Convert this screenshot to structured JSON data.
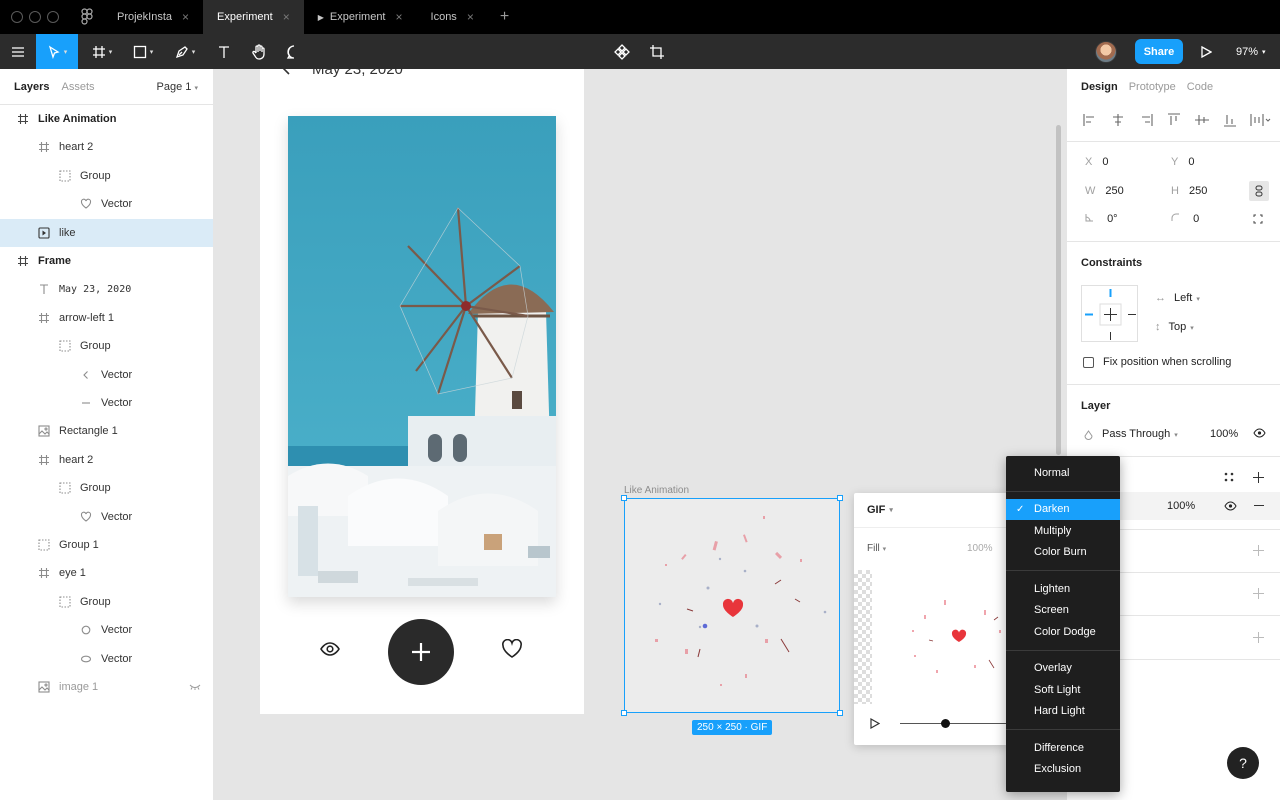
{
  "tabs": {
    "items": [
      {
        "label": "ProjekInsta",
        "active": false
      },
      {
        "label": "Experiment",
        "active": true
      },
      {
        "label": "Experiment",
        "active": false,
        "prototype": true
      },
      {
        "label": "Icons",
        "active": false
      }
    ],
    "close_glyph": "×",
    "add_glyph": "+"
  },
  "toolbar": {
    "share_label": "Share",
    "zoom_label": "97%",
    "caret": "▾",
    "icons": [
      "menu-icon",
      "move-tool-icon",
      "frame-tool-icon",
      "shape-tool-icon",
      "pen-tool-icon",
      "text-tool-icon",
      "hand-tool-icon",
      "comment-tool-icon",
      "component-icon",
      "crop-icon",
      "present-icon"
    ]
  },
  "layers_panel": {
    "tab_layers": "Layers",
    "tab_assets": "Assets",
    "page_label": "Page 1",
    "items": [
      {
        "label": "Like Animation",
        "icon": "frame-icon",
        "indent": 0,
        "bold": true
      },
      {
        "label": "heart 2",
        "icon": "frame-icon",
        "indent": 1
      },
      {
        "label": "Group",
        "icon": "group-icon",
        "indent": 2
      },
      {
        "label": "Vector",
        "icon": "heart-icon",
        "indent": 3
      },
      {
        "label": "like",
        "icon": "gif-icon",
        "indent": 1,
        "selected": true
      },
      {
        "label": "Frame",
        "icon": "frame-icon",
        "indent": 0,
        "bold": true
      },
      {
        "label": "May 23, 2020",
        "icon": "text-icon",
        "indent": 1,
        "mono": true
      },
      {
        "label": "arrow-left 1",
        "icon": "frame-icon",
        "indent": 1
      },
      {
        "label": "Group",
        "icon": "group-icon",
        "indent": 2
      },
      {
        "label": "Vector",
        "icon": "chevron-left-icon",
        "indent": 3
      },
      {
        "label": "Vector",
        "icon": "line-icon",
        "indent": 3
      },
      {
        "label": "Rectangle 1",
        "icon": "image-icon",
        "indent": 1
      },
      {
        "label": "heart 2",
        "icon": "frame-icon",
        "indent": 1
      },
      {
        "label": "Group",
        "icon": "group-icon",
        "indent": 2
      },
      {
        "label": "Vector",
        "icon": "heart-icon",
        "indent": 3
      },
      {
        "label": "Group 1",
        "icon": "group-icon",
        "indent": 1
      },
      {
        "label": "eye 1",
        "icon": "frame-icon",
        "indent": 1
      },
      {
        "label": "Group",
        "icon": "group-icon",
        "indent": 2
      },
      {
        "label": "Vector",
        "icon": "circle-icon",
        "indent": 3
      },
      {
        "label": "Vector",
        "icon": "ellipse-icon",
        "indent": 3
      },
      {
        "label": "image 1",
        "icon": "image-icon",
        "indent": 1,
        "muted": true,
        "hidden": true
      }
    ]
  },
  "canvas": {
    "frame_date": "May 23, 2020",
    "anim_label": "Like Animation",
    "size_badge": "250 × 250 · GIF"
  },
  "gif_popup": {
    "title": "GIF",
    "fill_label": "Fill",
    "fill_pct": "100%",
    "playback_progress": 0.42
  },
  "design_panel": {
    "tabs": [
      "Design",
      "Prototype",
      "Code"
    ],
    "x_label": "X",
    "x_value": "0",
    "y_label": "Y",
    "y_value": "0",
    "w_label": "W",
    "w_value": "250",
    "h_label": "H",
    "h_value": "250",
    "rotation": "0°",
    "radius": "0",
    "constraints_title": "Constraints",
    "constraint_h": "Left",
    "constraint_v": "Top",
    "fix_scroll_label": "Fix position when scrolling",
    "layer_title": "Layer",
    "blend_mode": "Pass Through",
    "opacity": "100%",
    "fill_opacity": "100%"
  },
  "blend_menu": {
    "groups": [
      [
        "Normal"
      ],
      [
        "Darken",
        "Multiply",
        "Color Burn"
      ],
      [
        "Lighten",
        "Screen",
        "Color Dodge"
      ],
      [
        "Overlay",
        "Soft Light",
        "Hard Light"
      ],
      [
        "Difference",
        "Exclusion"
      ]
    ],
    "selected": "Darken",
    "check_glyph": "✓"
  },
  "help_label": "?",
  "colors": {
    "accent": "#18a0fb",
    "toolbar_bg": "#2c2c2c",
    "selection": "#daebf7",
    "heart": "#e8353b"
  }
}
